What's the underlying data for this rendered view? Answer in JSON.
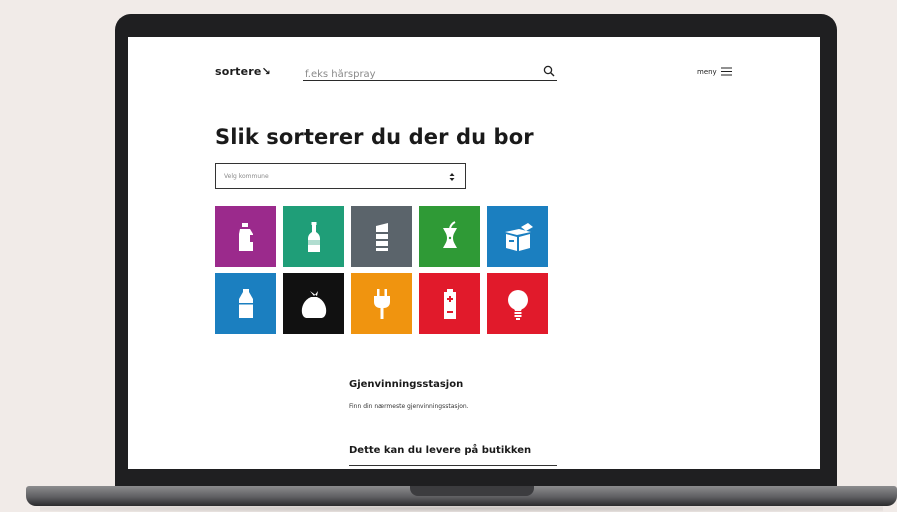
{
  "header": {
    "logo": "sortere↘",
    "search_placeholder": "f.eks hårspray",
    "menu_label": "meny"
  },
  "main": {
    "heading": "Slik sorterer du der du bor",
    "municipality_select": {
      "value": "Velg kommune"
    },
    "categories": [
      {
        "icon": "detergent-bottle-icon",
        "color": "#9b2a8c"
      },
      {
        "icon": "glass-bottle-icon",
        "color": "#1f9e78"
      },
      {
        "icon": "metal-can-icon",
        "color": "#5b646b"
      },
      {
        "icon": "apple-core-icon",
        "color": "#2f9a36"
      },
      {
        "icon": "cardboard-box-icon",
        "color": "#1b7fc0"
      },
      {
        "icon": "plastic-bottle-icon",
        "color": "#1b7fc0"
      },
      {
        "icon": "trash-bag-icon",
        "color": "#111111"
      },
      {
        "icon": "electric-plug-icon",
        "color": "#f0940f"
      },
      {
        "icon": "battery-icon",
        "color": "#e11a2b"
      },
      {
        "icon": "light-bulb-icon",
        "color": "#e11a2b"
      }
    ],
    "recycling_station": {
      "title": "Gjenvinningsstasjon",
      "text": "Finn din nærmeste gjenvinningsstasjon."
    },
    "store_section": {
      "title": "Dette kan du levere på butikken"
    }
  }
}
